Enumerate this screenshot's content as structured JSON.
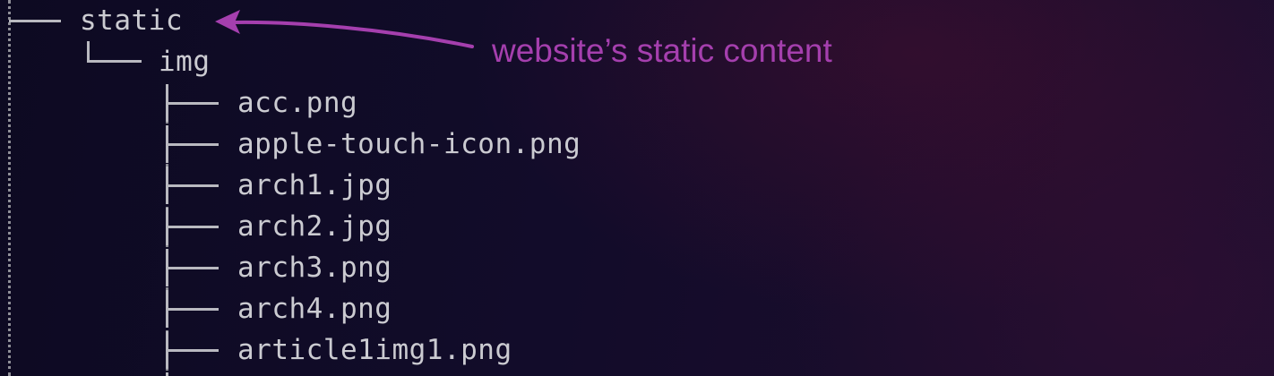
{
  "tree": {
    "root_entry": "static",
    "sub_entry": "img",
    "files": [
      "acc.png",
      "apple-touch-icon.png",
      "arch1.jpg",
      "arch2.jpg",
      "arch3.png",
      "arch4.png",
      "article1img1.png"
    ]
  },
  "annotation": {
    "label": "website’s static content",
    "color": "#a53fae",
    "icon": "arrow-left-icon"
  }
}
